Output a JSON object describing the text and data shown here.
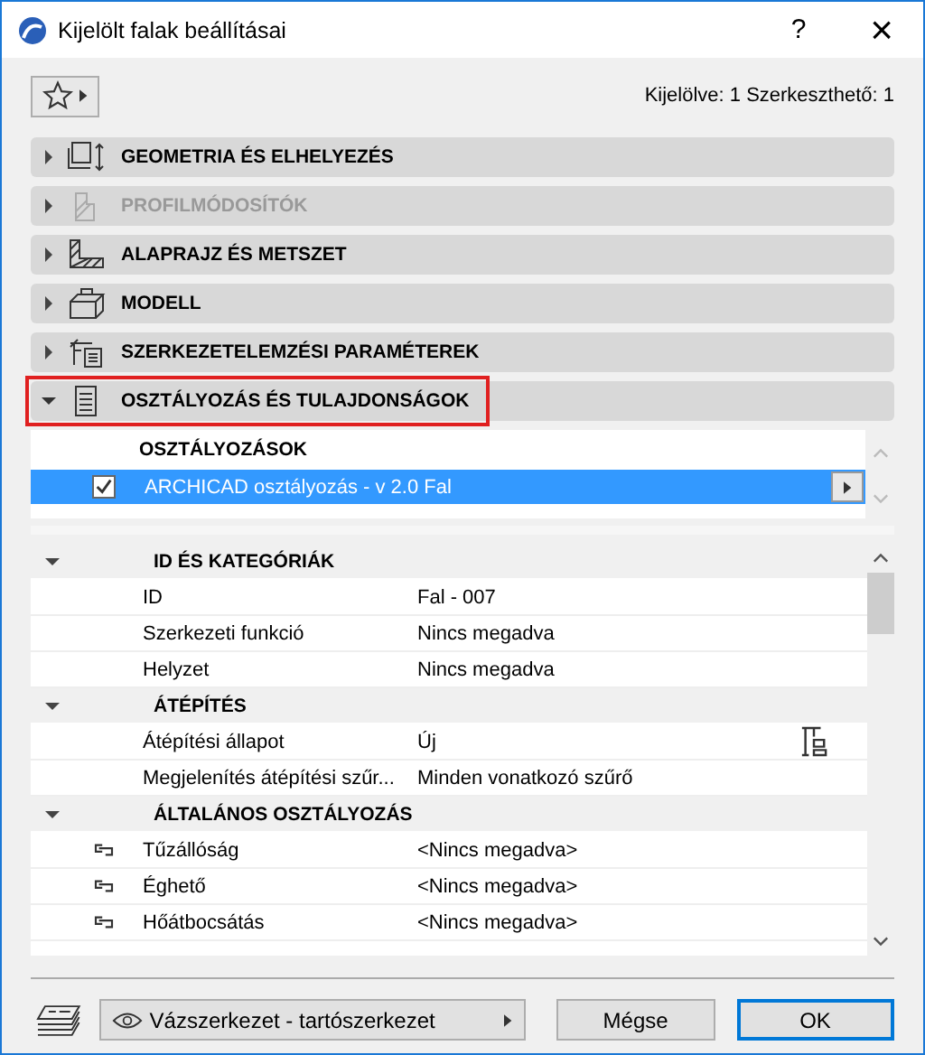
{
  "window": {
    "title": "Kijelölt falak beállításai",
    "help": "?",
    "close": "×"
  },
  "selection_info": "Kijelölve: 1 Szerkeszthető: 1",
  "sections": [
    {
      "label": "GEOMETRIA ÉS ELHELYEZÉS",
      "disabled": false,
      "expanded": false,
      "highlighted": false
    },
    {
      "label": "PROFILMÓDOSÍTÓK",
      "disabled": true,
      "expanded": false,
      "highlighted": false
    },
    {
      "label": "ALAPRAJZ ÉS METSZET",
      "disabled": false,
      "expanded": false,
      "highlighted": false
    },
    {
      "label": "MODELL",
      "disabled": false,
      "expanded": false,
      "highlighted": false
    },
    {
      "label": "SZERKEZETELEMZÉSI PARAMÉTEREK",
      "disabled": false,
      "expanded": false,
      "highlighted": false
    },
    {
      "label": "OSZTÁLYOZÁS ÉS TULAJDONSÁGOK",
      "disabled": false,
      "expanded": true,
      "highlighted": true
    }
  ],
  "classifications": {
    "heading": "OSZTÁLYOZÁSOK",
    "items": [
      {
        "label": "ARCHICAD osztályozás - v 2.0 Fal",
        "checked": true,
        "selected": true
      }
    ]
  },
  "properties": [
    {
      "group": "ID ÉS KATEGÓRIÁK",
      "expanded": true,
      "rows": [
        {
          "label": "ID",
          "value": "Fal - 007",
          "kind": "plain"
        },
        {
          "label": "Szerkezeti funkció",
          "value": "Nincs megadva",
          "kind": "plain"
        },
        {
          "label": "Helyzet",
          "value": "Nincs megadva",
          "kind": "plain"
        }
      ]
    },
    {
      "group": "ÁTÉPÍTÉS",
      "expanded": true,
      "rows": [
        {
          "label": "Átépítési állapot",
          "value": "Új",
          "kind": "renovation"
        },
        {
          "label": "Megjelenítés átépítési szűr...",
          "value": "Minden vonatkozó szűrő",
          "kind": "plain"
        }
      ]
    },
    {
      "group": "ÁLTALÁNOS OSZTÁLYOZÁS",
      "expanded": true,
      "rows": [
        {
          "label": "Tűzállóság",
          "value": "<Nincs megadva>",
          "kind": "linked"
        },
        {
          "label": "Éghető",
          "value": "<Nincs megadva>",
          "kind": "linked"
        },
        {
          "label": "Hőátbocsátás",
          "value": "<Nincs megadva>",
          "kind": "linked"
        }
      ]
    }
  ],
  "footer": {
    "layer": "Vázszerkezet - tartószerkezet",
    "cancel": "Mégse",
    "ok": "OK"
  }
}
